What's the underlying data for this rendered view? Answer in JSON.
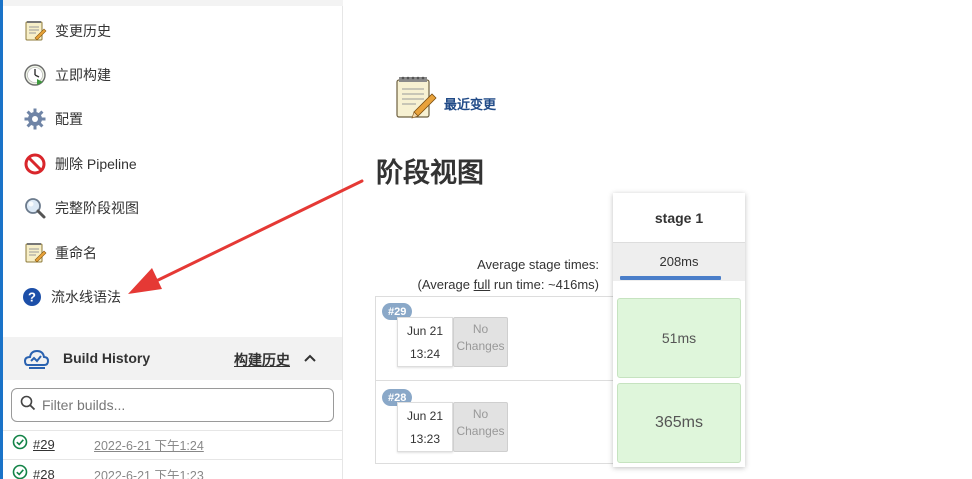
{
  "sidebar": {
    "tasks": [
      {
        "label": "变更历史",
        "icon": "notepad-icon"
      },
      {
        "label": "立即构建",
        "icon": "clock-build-icon"
      },
      {
        "label": "配置",
        "icon": "gear-icon"
      },
      {
        "label": "删除 Pipeline",
        "icon": "no-entry-icon"
      },
      {
        "label": "完整阶段视图",
        "icon": "magnifier-icon"
      },
      {
        "label": "重命名",
        "icon": "notepad-icon"
      },
      {
        "label": "流水线语法",
        "icon": "help-icon"
      }
    ],
    "build_history": {
      "title": "Build History",
      "link": "构建历史",
      "filter_placeholder": "Filter builds...",
      "builds": [
        {
          "number": "#29",
          "date": "2022-6-21 下午1:24",
          "status": "success"
        },
        {
          "number": "#28",
          "date": "2022-6-21 下午1:23",
          "status": "success"
        }
      ]
    }
  },
  "main": {
    "recent_changes": "最近变更",
    "stage_view_title": "阶段视图",
    "avg_stage_times": "Average stage times:",
    "avg_full_prefix": "(Average ",
    "avg_full_word": "full",
    "avg_full_suffix": " run time: ~416ms)",
    "stage": {
      "name": "stage 1",
      "avg": "208ms",
      "avg_bar_fraction": 0.86
    },
    "runs": [
      {
        "number": "#29",
        "date": "Jun 21",
        "time": "13:24",
        "changes_1": "No",
        "changes_2": "Changes",
        "duration": "51ms"
      },
      {
        "number": "#28",
        "date": "Jun 21",
        "time": "13:23",
        "changes_1": "No",
        "changes_2": "Changes",
        "duration": "365ms"
      }
    ]
  },
  "colors": {
    "accent": "#1a73c8",
    "success_cell": "#dff6db",
    "badge": "#8aa8c8",
    "annotation_arrow": "#e53935",
    "status_ok": "#138347"
  }
}
